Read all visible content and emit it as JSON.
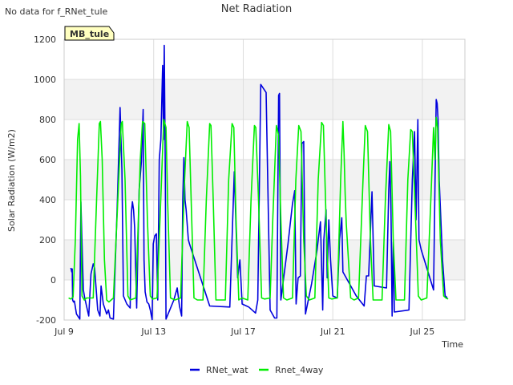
{
  "header": {
    "no_data_text": "No data for f_RNet_tule",
    "site_label": "MB_tule"
  },
  "chart_data": {
    "type": "line",
    "title": "Net Radiation",
    "xlabel": "Time",
    "ylabel": "Solar Radiation (W/m2)",
    "ylim": [
      -200,
      1200
    ],
    "xlim": [
      9.0,
      26.9
    ],
    "yticks": [
      -200,
      0,
      200,
      400,
      600,
      800,
      1000,
      1200
    ],
    "xticks": [
      {
        "value": 9,
        "label": "Jul 9"
      },
      {
        "value": 13,
        "label": "Jul 13"
      },
      {
        "value": 17,
        "label": "Jul 17"
      },
      {
        "value": 21,
        "label": "Jul 21"
      },
      {
        "value": 25,
        "label": "Jul 25"
      }
    ],
    "grid": true,
    "alternating_bands": true,
    "legend_position": "bottom-center",
    "series": [
      {
        "name": "RNet_wat",
        "color": "#0000dd",
        "points": [
          [
            9.3,
            60
          ],
          [
            9.34,
            40
          ],
          [
            9.36,
            55
          ],
          [
            9.38,
            -100
          ],
          [
            9.42,
            -110
          ],
          [
            9.46,
            -105
          ],
          [
            9.55,
            -170
          ],
          [
            9.7,
            -195
          ],
          [
            9.75,
            390
          ],
          [
            9.82,
            100
          ],
          [
            9.86,
            -50
          ],
          [
            9.92,
            -90
          ],
          [
            10.02,
            -140
          ],
          [
            10.1,
            -180
          ],
          [
            10.2,
            30
          ],
          [
            10.3,
            80
          ],
          [
            10.36,
            60
          ],
          [
            10.5,
            -150
          ],
          [
            10.6,
            -180
          ],
          [
            10.65,
            -30
          ],
          [
            10.75,
            -120
          ],
          [
            10.9,
            -170
          ],
          [
            10.98,
            -150
          ],
          [
            11.05,
            -190
          ],
          [
            11.2,
            -195
          ],
          [
            11.38,
            400
          ],
          [
            11.5,
            860
          ],
          [
            11.58,
            550
          ],
          [
            11.65,
            -80
          ],
          [
            11.8,
            -120
          ],
          [
            11.95,
            -140
          ],
          [
            12.0,
            330
          ],
          [
            12.05,
            390
          ],
          [
            12.1,
            350
          ],
          [
            12.15,
            260
          ],
          [
            12.24,
            -140
          ],
          [
            12.35,
            450
          ],
          [
            12.45,
            590
          ],
          [
            12.53,
            850
          ],
          [
            12.57,
            100
          ],
          [
            12.62,
            -60
          ],
          [
            12.7,
            -110
          ],
          [
            12.78,
            -120
          ],
          [
            12.85,
            -150
          ],
          [
            12.9,
            -180
          ],
          [
            12.93,
            -198
          ],
          [
            12.98,
            180
          ],
          [
            13.05,
            220
          ],
          [
            13.12,
            230
          ],
          [
            13.18,
            -100
          ],
          [
            13.25,
            600
          ],
          [
            13.32,
            700
          ],
          [
            13.4,
            1070
          ],
          [
            13.44,
            700
          ],
          [
            13.47,
            1170
          ],
          [
            13.5,
            800
          ],
          [
            13.52,
            500
          ],
          [
            13.55,
            -195
          ],
          [
            13.9,
            -100
          ],
          [
            14.05,
            -40
          ],
          [
            14.15,
            -130
          ],
          [
            14.25,
            -180
          ],
          [
            14.3,
            400
          ],
          [
            14.35,
            610
          ],
          [
            14.4,
            400
          ],
          [
            14.45,
            350
          ],
          [
            14.55,
            200
          ],
          [
            14.6,
            180
          ],
          [
            15.5,
            -130
          ],
          [
            16.4,
            -135
          ],
          [
            16.6,
            540
          ],
          [
            16.75,
            10
          ],
          [
            16.85,
            100
          ],
          [
            16.95,
            -120
          ],
          [
            17.25,
            -135
          ],
          [
            17.55,
            -165
          ],
          [
            17.65,
            -100
          ],
          [
            17.78,
            975
          ],
          [
            18.02,
            935
          ],
          [
            18.2,
            -150
          ],
          [
            18.4,
            -190
          ],
          [
            18.5,
            -190
          ],
          [
            18.58,
            920
          ],
          [
            18.62,
            930
          ],
          [
            18.68,
            -100
          ],
          [
            19.0,
            180
          ],
          [
            19.2,
            380
          ],
          [
            19.3,
            445
          ],
          [
            19.36,
            -120
          ],
          [
            19.45,
            10
          ],
          [
            19.55,
            20
          ],
          [
            19.62,
            680
          ],
          [
            19.7,
            690
          ],
          [
            19.78,
            -170
          ],
          [
            20.05,
            -20
          ],
          [
            20.3,
            150
          ],
          [
            20.35,
            200
          ],
          [
            20.45,
            290
          ],
          [
            20.55,
            -150
          ],
          [
            20.6,
            200
          ],
          [
            20.7,
            350
          ],
          [
            20.75,
            10
          ],
          [
            20.82,
            300
          ],
          [
            20.9,
            100
          ],
          [
            21.0,
            -80
          ],
          [
            21.2,
            -90
          ],
          [
            21.3,
            200
          ],
          [
            21.4,
            310
          ],
          [
            21.45,
            40
          ],
          [
            22.05,
            -80
          ],
          [
            22.4,
            -130
          ],
          [
            22.5,
            20
          ],
          [
            22.6,
            20
          ],
          [
            22.75,
            440
          ],
          [
            22.85,
            -30
          ],
          [
            23.4,
            -40
          ],
          [
            23.5,
            450
          ],
          [
            23.55,
            590
          ],
          [
            23.6,
            340
          ],
          [
            23.65,
            -180
          ],
          [
            23.7,
            190
          ],
          [
            23.75,
            -160
          ],
          [
            24.4,
            -150
          ],
          [
            24.55,
            500
          ],
          [
            24.65,
            740
          ],
          [
            24.72,
            300
          ],
          [
            24.8,
            800
          ],
          [
            24.85,
            200
          ],
          [
            24.95,
            150
          ],
          [
            25.5,
            -50
          ],
          [
            25.58,
            600
          ],
          [
            25.62,
            900
          ],
          [
            25.66,
            880
          ],
          [
            25.7,
            800
          ],
          [
            25.75,
            500
          ],
          [
            25.9,
            100
          ],
          [
            26.0,
            -60
          ],
          [
            26.02,
            -80
          ],
          [
            26.08,
            -85
          ],
          [
            26.12,
            -95
          ]
        ]
      },
      {
        "name": "Rnet_4way",
        "color": "#00ee00",
        "points": [
          [
            9.2,
            -90
          ],
          [
            9.3,
            -95
          ],
          [
            9.4,
            -85
          ],
          [
            9.5,
            200
          ],
          [
            9.6,
            700
          ],
          [
            9.67,
            780
          ],
          [
            9.73,
            520
          ],
          [
            9.8,
            -80
          ],
          [
            9.9,
            -100
          ],
          [
            10.0,
            -90
          ],
          [
            10.3,
            -90
          ],
          [
            10.45,
            400
          ],
          [
            10.57,
            780
          ],
          [
            10.62,
            790
          ],
          [
            10.7,
            600
          ],
          [
            10.8,
            100
          ],
          [
            10.9,
            -100
          ],
          [
            11.0,
            -110
          ],
          [
            11.2,
            -90
          ],
          [
            11.4,
            400
          ],
          [
            11.55,
            780
          ],
          [
            11.6,
            790
          ],
          [
            11.72,
            500
          ],
          [
            11.85,
            -80
          ],
          [
            11.95,
            -100
          ],
          [
            12.2,
            -90
          ],
          [
            12.4,
            600
          ],
          [
            12.5,
            790
          ],
          [
            12.6,
            780
          ],
          [
            12.72,
            300
          ],
          [
            12.85,
            -80
          ],
          [
            12.95,
            -95
          ],
          [
            13.15,
            -90
          ],
          [
            13.35,
            500
          ],
          [
            13.45,
            800
          ],
          [
            13.55,
            760
          ],
          [
            13.62,
            400
          ],
          [
            13.75,
            -90
          ],
          [
            13.95,
            -100
          ],
          [
            14.2,
            -90
          ],
          [
            14.38,
            500
          ],
          [
            14.5,
            790
          ],
          [
            14.58,
            760
          ],
          [
            14.7,
            300
          ],
          [
            14.8,
            -90
          ],
          [
            14.95,
            -100
          ],
          [
            15.2,
            -100
          ],
          [
            15.35,
            400
          ],
          [
            15.5,
            780
          ],
          [
            15.56,
            770
          ],
          [
            15.66,
            400
          ],
          [
            15.78,
            -100
          ],
          [
            15.95,
            -100
          ],
          [
            16.2,
            -100
          ],
          [
            16.35,
            500
          ],
          [
            16.5,
            780
          ],
          [
            16.58,
            760
          ],
          [
            16.68,
            300
          ],
          [
            16.8,
            -100
          ],
          [
            16.95,
            -90
          ],
          [
            17.2,
            -100
          ],
          [
            17.35,
            400
          ],
          [
            17.5,
            770
          ],
          [
            17.56,
            760
          ],
          [
            17.68,
            400
          ],
          [
            17.82,
            -90
          ],
          [
            17.95,
            -95
          ],
          [
            18.2,
            -90
          ],
          [
            18.32,
            300
          ],
          [
            18.48,
            770
          ],
          [
            18.58,
            720
          ],
          [
            18.68,
            300
          ],
          [
            18.8,
            -90
          ],
          [
            18.95,
            -100
          ],
          [
            19.2,
            -90
          ],
          [
            19.35,
            500
          ],
          [
            19.48,
            770
          ],
          [
            19.58,
            740
          ],
          [
            19.7,
            200
          ],
          [
            19.82,
            -80
          ],
          [
            19.95,
            -100
          ],
          [
            20.2,
            -90
          ],
          [
            20.35,
            500
          ],
          [
            20.5,
            785
          ],
          [
            20.58,
            770
          ],
          [
            20.7,
            300
          ],
          [
            20.82,
            -90
          ],
          [
            20.95,
            -95
          ],
          [
            21.2,
            -90
          ],
          [
            21.35,
            500
          ],
          [
            21.45,
            790
          ],
          [
            21.5,
            640
          ],
          [
            21.55,
            430
          ],
          [
            21.6,
            280
          ],
          [
            21.7,
            100
          ],
          [
            21.8,
            -90
          ],
          [
            21.95,
            -100
          ],
          [
            22.15,
            -90
          ],
          [
            22.35,
            500
          ],
          [
            22.45,
            770
          ],
          [
            22.55,
            740
          ],
          [
            22.68,
            200
          ],
          [
            22.8,
            -100
          ],
          [
            22.95,
            -100
          ],
          [
            23.2,
            -100
          ],
          [
            23.35,
            400
          ],
          [
            23.5,
            775
          ],
          [
            23.58,
            740
          ],
          [
            23.7,
            200
          ],
          [
            23.82,
            -100
          ],
          [
            23.95,
            -100
          ],
          [
            24.2,
            -100
          ],
          [
            24.35,
            500
          ],
          [
            24.48,
            750
          ],
          [
            24.55,
            740
          ],
          [
            24.7,
            300
          ],
          [
            24.82,
            -80
          ],
          [
            24.95,
            -100
          ],
          [
            25.2,
            -90
          ],
          [
            25.38,
            400
          ],
          [
            25.5,
            760
          ],
          [
            25.56,
            600
          ],
          [
            25.62,
            810
          ],
          [
            25.68,
            760
          ],
          [
            25.8,
            200
          ],
          [
            25.95,
            -80
          ],
          [
            26.05,
            -90
          ],
          [
            26.15,
            -95
          ]
        ]
      }
    ]
  }
}
